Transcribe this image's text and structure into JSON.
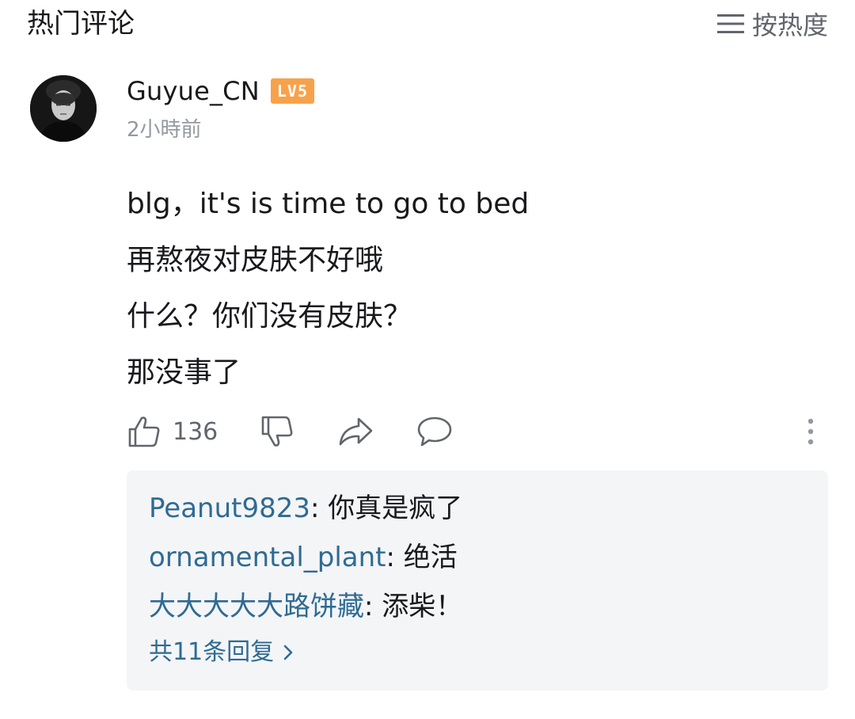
{
  "header": {
    "title": "热门评论",
    "sort_label": "按热度",
    "sort_icon": "menu-lines-icon"
  },
  "comment": {
    "username": "Guyue_CN",
    "level_badge": "LV5",
    "timestamp": "2小時前",
    "lines": [
      "blg，it's is time to go to bed",
      "再熬夜对皮肤不好哦",
      "什么？你们没有皮肤？",
      "那没事了"
    ],
    "like_count": "136",
    "icons": {
      "like": "thumbs-up-icon",
      "dislike": "thumbs-down-icon",
      "share": "share-arrow-icon",
      "reply": "speech-bubble-icon",
      "more": "more-vertical-icon"
    }
  },
  "replies": {
    "items": [
      {
        "author": "Peanut9823",
        "text": "你真是疯了"
      },
      {
        "author": "ornamental_plant",
        "text": "绝活"
      },
      {
        "author": "大大大大大路饼藏",
        "text": "添柴！"
      }
    ],
    "separator": ": ",
    "more_label": "共11条回复"
  },
  "colors": {
    "link": "#2f6b93",
    "secondary": "#61666d",
    "muted": "#9499a0",
    "badge": "#f7a24b",
    "reply_bg": "#f4f5f7"
  }
}
